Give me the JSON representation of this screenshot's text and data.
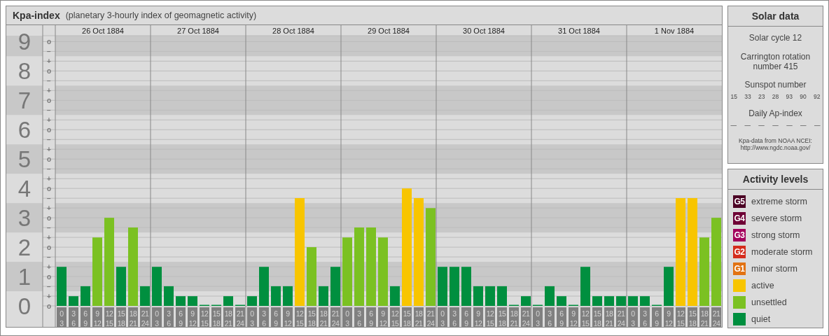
{
  "kpa_panel": {
    "title": "Kpa-index",
    "subtitle": "(planetary 3-hourly index of geomagnetic activity)",
    "days": [
      "26 Oct 1884",
      "27 Oct 1884",
      "28 Oct 1884",
      "29 Oct 1884",
      "30 Oct 1884",
      "31 Oct 1884",
      "1 Nov 1884"
    ],
    "chart_data": {
      "type": "bar",
      "categories": [
        "0\n3",
        "3\n6",
        "6\n9",
        "9\n12",
        "12\n15",
        "15\n18",
        "18\n21",
        "21\n24",
        "0\n3",
        "3\n6",
        "6\n9",
        "9\n12",
        "12\n15",
        "15\n18",
        "18\n21",
        "21\n24",
        "0\n3",
        "3\n6",
        "6\n9",
        "9\n12",
        "12\n15",
        "15\n18",
        "18\n21",
        "21\n24",
        "0\n3",
        "3\n6",
        "6\n9",
        "9\n12",
        "12\n15",
        "15\n18",
        "18\n21",
        "21\n24",
        "0\n3",
        "3\n6",
        "6\n9",
        "9\n12",
        "12\n15",
        "15\n18",
        "18\n21",
        "21\n24",
        "0\n3",
        "3\n6",
        "6\n9",
        "9\n12",
        "12\n15",
        "15\n18",
        "18\n21",
        "21\n24",
        "0\n3",
        "3\n6",
        "6\n9",
        "9\n12",
        "12\n15",
        "15\n18",
        "18\n21",
        "21\n24"
      ],
      "series": [
        {
          "color": "#008f3f",
          "values": [
            1.33,
            0.33,
            0.67,
            null,
            null,
            1.33,
            null,
            0.67,
            1.33,
            0.67,
            0.33,
            0.33,
            0,
            0,
            0.33,
            0,
            0.33,
            1.33,
            0.67,
            0.67,
            null,
            null,
            0.67,
            1.33,
            null,
            null,
            null,
            null,
            0.67,
            null,
            null,
            null,
            1.33,
            1.33,
            1.33,
            0.67,
            0.67,
            0.67,
            0,
            0.33,
            0,
            0.67,
            0.33,
            0,
            1.33,
            0.33,
            0.33,
            0.33,
            0.33,
            0.33,
            0,
            1.33,
            null,
            null,
            null,
            null
          ]
        },
        {
          "color": "#7bc122",
          "values": [
            null,
            null,
            null,
            2.33,
            3,
            null,
            2.67,
            null,
            null,
            null,
            null,
            null,
            null,
            null,
            null,
            null,
            null,
            null,
            null,
            null,
            null,
            2,
            null,
            null,
            2.33,
            2.67,
            2.67,
            2.33,
            null,
            null,
            null,
            3.33,
            null,
            null,
            null,
            null,
            null,
            null,
            null,
            null,
            null,
            null,
            null,
            null,
            null,
            null,
            null,
            null,
            null,
            null,
            null,
            null,
            null,
            null,
            2.33,
            3
          ]
        },
        {
          "color": "#f8c500",
          "values": [
            null,
            null,
            null,
            null,
            null,
            null,
            null,
            null,
            null,
            null,
            null,
            null,
            null,
            null,
            null,
            null,
            null,
            null,
            null,
            null,
            3.67,
            null,
            null,
            null,
            null,
            null,
            null,
            null,
            null,
            4,
            3.67,
            null,
            null,
            null,
            null,
            null,
            null,
            null,
            null,
            null,
            null,
            null,
            null,
            null,
            null,
            null,
            null,
            null,
            null,
            null,
            null,
            null,
            3.67,
            3.67,
            null,
            null
          ]
        }
      ],
      "ylim": [
        0,
        9.2
      ],
      "grid": true,
      "yticks": [
        {
          "value": 0,
          "label": "0"
        },
        {
          "value": 1,
          "label": "1"
        },
        {
          "value": 2,
          "label": "2"
        },
        {
          "value": 3,
          "label": "3"
        },
        {
          "value": 4,
          "label": "4"
        },
        {
          "value": 5,
          "label": "5"
        },
        {
          "value": 6,
          "label": "6"
        },
        {
          "value": 7,
          "label": "7"
        },
        {
          "value": 8,
          "label": "8"
        },
        {
          "value": 9,
          "label": "9"
        }
      ]
    },
    "minor_tick_labels": [
      "o",
      "−",
      "+",
      "o",
      "−",
      "+",
      "o",
      "−",
      "+",
      "o",
      "−",
      "+",
      "o",
      "−",
      "+",
      "o",
      "−",
      "+",
      "o",
      "−",
      "+",
      "o",
      "−",
      "+",
      "o",
      "−",
      "+",
      "o"
    ]
  },
  "solar_data": {
    "title": "Solar data",
    "cycle": "Solar cycle 12",
    "carrington": "Carrington rotation number 415",
    "sunspot_label": "Sunspot number",
    "sunspot_numbers": [
      "15",
      "33",
      "23",
      "28",
      "93",
      "90",
      "92"
    ],
    "ap_label": "Daily Ap-index",
    "ap_values": [
      "—",
      "—",
      "—",
      "—",
      "—",
      "—",
      "—"
    ],
    "source": "Kpa-data from NOAA NCEI:",
    "source_url": "http://www.ngdc.noaa.gov/"
  },
  "activity_levels": {
    "title": "Activity levels",
    "items": [
      {
        "code": "G5",
        "label": "extreme storm",
        "color": "#4b0024"
      },
      {
        "code": "G4",
        "label": "severe storm",
        "color": "#6e0035"
      },
      {
        "code": "G3",
        "label": "strong storm",
        "color": "#a3005c"
      },
      {
        "code": "G2",
        "label": "moderate storm",
        "color": "#d42c1c"
      },
      {
        "code": "G1",
        "label": "minor storm",
        "color": "#e27212"
      },
      {
        "label": "active",
        "color": "#f8c500"
      },
      {
        "label": "unsettled",
        "color": "#7bc122"
      },
      {
        "label": "quiet",
        "color": "#008f3f"
      }
    ]
  }
}
